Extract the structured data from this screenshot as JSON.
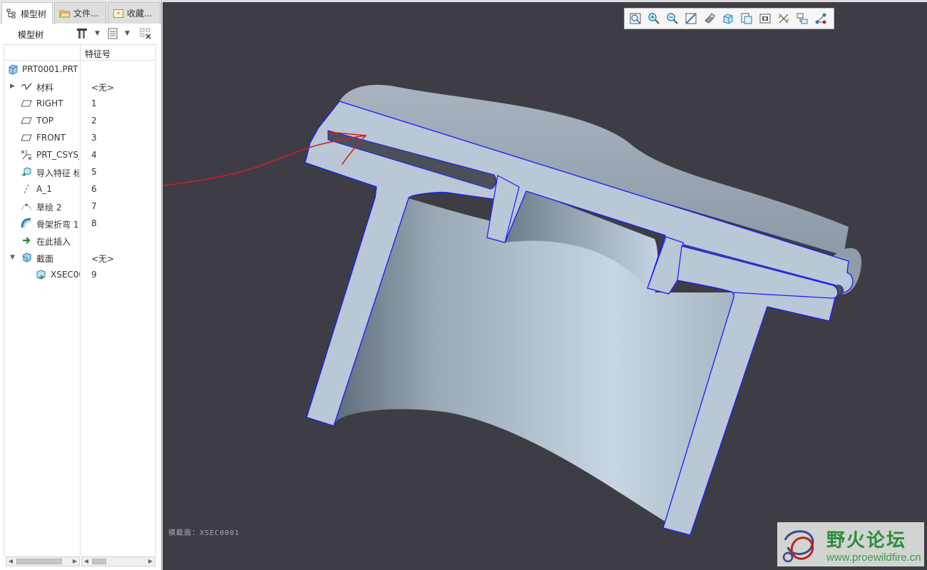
{
  "tabs": [
    {
      "label": "模型树",
      "icon": "model-tree-icon",
      "active": true
    },
    {
      "label": "文件...",
      "icon": "folder-icon",
      "active": false
    },
    {
      "label": "收藏...",
      "icon": "favorites-icon",
      "active": false
    }
  ],
  "tree_toolbar": {
    "title": "模型树",
    "buttons": [
      "settings-tools-icon",
      "show-columns-icon",
      "filter-icon"
    ]
  },
  "columns": {
    "name": "",
    "feature_id": "特征号"
  },
  "tree": {
    "root": {
      "label": "PRT0001.PRT",
      "icon": "part-icon"
    },
    "items": [
      {
        "label": "材料",
        "feature": "<无>",
        "icon": "material-icon",
        "expander": "collapsed"
      },
      {
        "label": "RIGHT",
        "feature": "1",
        "icon": "datum-plane-icon"
      },
      {
        "label": "TOP",
        "feature": "2",
        "icon": "datum-plane-icon"
      },
      {
        "label": "FRONT",
        "feature": "3",
        "icon": "datum-plane-icon"
      },
      {
        "label": "PRT_CSYS_",
        "feature": "4",
        "icon": "coordinate-system-icon"
      },
      {
        "label": "导入特征 标",
        "feature": "5",
        "icon": "import-feature-icon"
      },
      {
        "label": "A_1",
        "feature": "6",
        "icon": "datum-axis-icon"
      },
      {
        "label": "草绘 2",
        "feature": "7",
        "icon": "sketch-icon"
      },
      {
        "label": "骨架折弯 1",
        "feature": "8",
        "icon": "spinal-bend-icon"
      },
      {
        "label": "在此插入",
        "feature": "",
        "icon": "insert-here-arrow-icon"
      },
      {
        "label": "截面",
        "feature": "<无>",
        "icon": "sections-icon",
        "expander": "expanded"
      },
      {
        "label": "XSEC00",
        "feature": "9",
        "icon": "cross-section-icon",
        "indent": true
      }
    ]
  },
  "view_toolbar": [
    "refit-icon",
    "zoom-in-icon",
    "zoom-out-icon",
    "repaint-icon",
    "display-style-icon",
    "saved-orientations-icon",
    "view-manager-icon",
    "perspective-view-icon",
    "datum-display-filter-icon",
    "spin-center-icon",
    "annotation-display-icon"
  ],
  "viewport": {
    "section_label": "横截面：XSEC0001",
    "background_color": "#3e3d45",
    "part_color": "#b8c6d4",
    "edge_color": "#1a1aff",
    "annotation_color": "#d02020"
  },
  "watermark": {
    "title": "野火论坛",
    "url": "www.proewildfire.cn",
    "color": "#2e8b3a"
  }
}
